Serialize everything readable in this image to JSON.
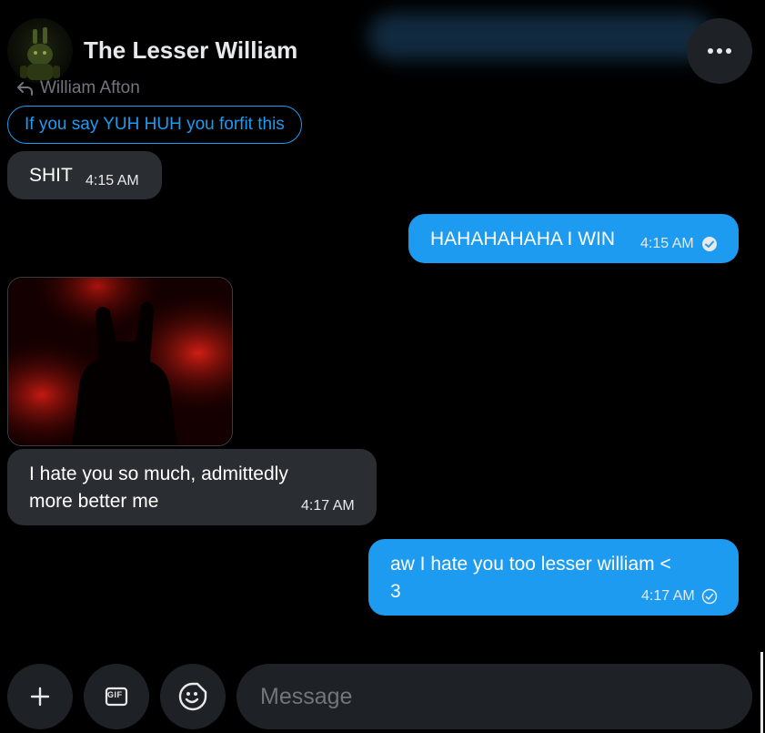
{
  "header": {
    "title": "The Lesser William",
    "avatar_icon": "springtrap-avatar",
    "more_icon": "more-options-icon"
  },
  "reply": {
    "reply_to": "William Afton",
    "quoted_text": "If you say YUH HUH you forfit this"
  },
  "messages": [
    {
      "direction": "incoming",
      "type": "text",
      "text": "SHIT",
      "time": "4:15 AM"
    },
    {
      "direction": "outgoing",
      "type": "text",
      "text": "HAHAHAHAHA I WIN",
      "time": "4:15 AM",
      "status": "read"
    },
    {
      "direction": "incoming",
      "type": "image",
      "image_desc": "dark red silhouette"
    },
    {
      "direction": "incoming",
      "type": "text",
      "lines": [
        "I hate you so much, admittedly",
        "more better me"
      ],
      "time": "4:17 AM"
    },
    {
      "direction": "outgoing",
      "type": "text",
      "lines": [
        "aw I hate you too lesser william <",
        "3"
      ],
      "time": "4:17 AM",
      "status": "sent"
    }
  ],
  "composer": {
    "placeholder": "Message",
    "add_icon": "plus-icon",
    "gif_label": "GIF",
    "emoji_icon": "emoji-icon"
  },
  "colors": {
    "accent": "#1d9bf0",
    "incoming_bubble": "#2a2d31",
    "background": "#000000",
    "button_bg": "#1e2226"
  }
}
